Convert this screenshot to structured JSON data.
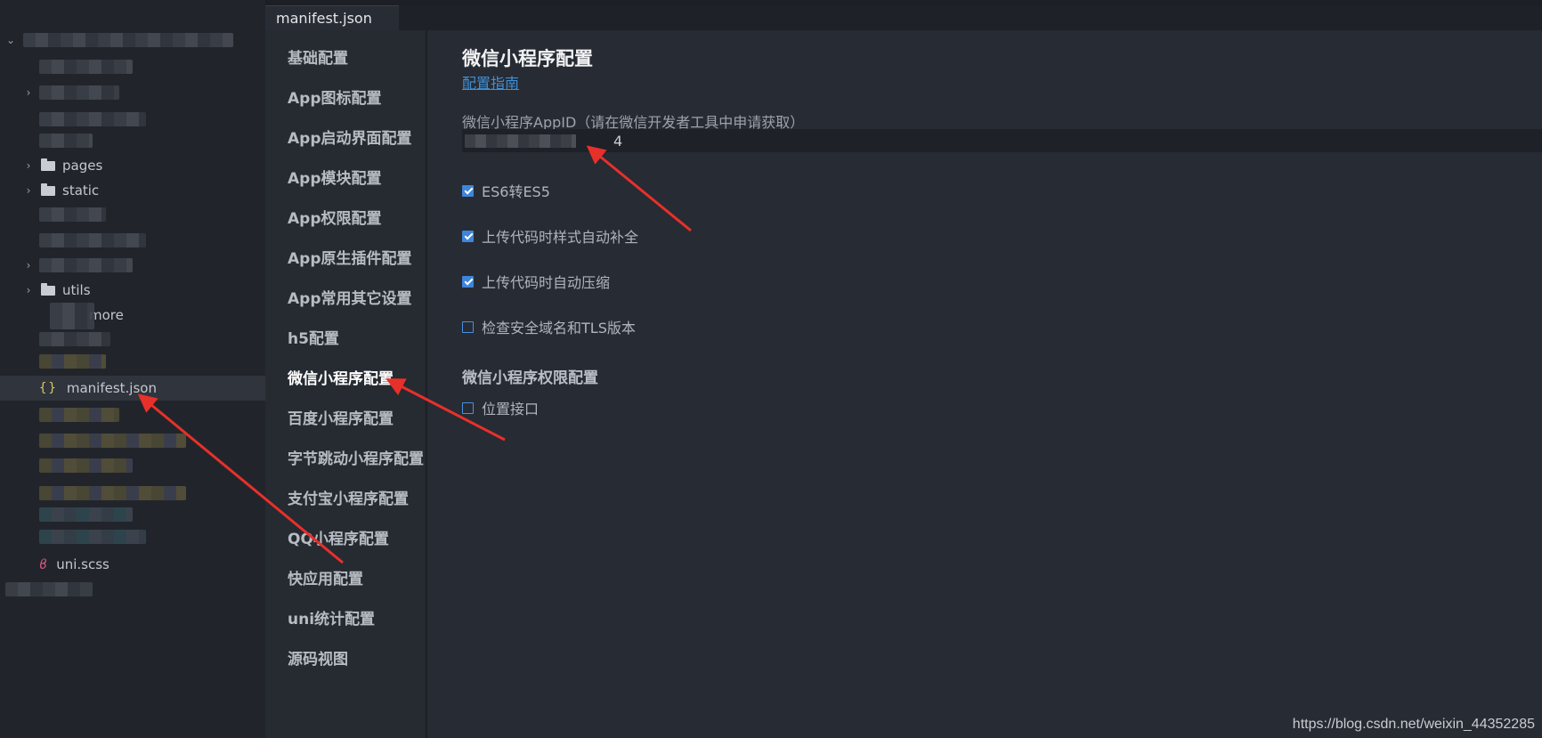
{
  "tab": {
    "title": "manifest.json"
  },
  "explorer": {
    "items": [
      {
        "label": "pages",
        "type": "folder"
      },
      {
        "label": "static",
        "type": "folder"
      },
      {
        "label": "utils",
        "type": "folder"
      },
      {
        "label": "more",
        "type": "file-partial"
      },
      {
        "label": "manifest.json",
        "type": "json",
        "selected": true
      },
      {
        "label": "uni.scss",
        "type": "scss"
      }
    ]
  },
  "nav": {
    "items": [
      "基础配置",
      "App图标配置",
      "App启动界面配置",
      "App模块配置",
      "App权限配置",
      "App原生插件配置",
      "App常用其它设置",
      "h5配置",
      "微信小程序配置",
      "百度小程序配置",
      "字节跳动小程序配置",
      "支付宝小程序配置",
      "QQ小程序配置",
      "快应用配置",
      "uni统计配置",
      "源码视图"
    ],
    "active": "微信小程序配置"
  },
  "content": {
    "title": "微信小程序配置",
    "guide_link": "配置指南",
    "appid_label": "微信小程序AppID（请在微信开发者工具中申请获取）",
    "appid_value_visible_suffix": "4",
    "options": [
      {
        "label": "ES6转ES5",
        "checked": true
      },
      {
        "label": "上传代码时样式自动补全",
        "checked": true
      },
      {
        "label": "上传代码时自动压缩",
        "checked": true
      },
      {
        "label": "检查安全域名和TLS版本",
        "checked": false
      }
    ],
    "permissions_title": "微信小程序权限配置",
    "permissions": [
      {
        "label": "位置接口",
        "checked": false
      }
    ]
  },
  "watermark": "https://blog.csdn.net/weixin_44352285",
  "colors": {
    "accent": "#3d86db",
    "link": "#3f8fd6",
    "annotation_arrow": "#e8302a",
    "background": "#272b33"
  }
}
